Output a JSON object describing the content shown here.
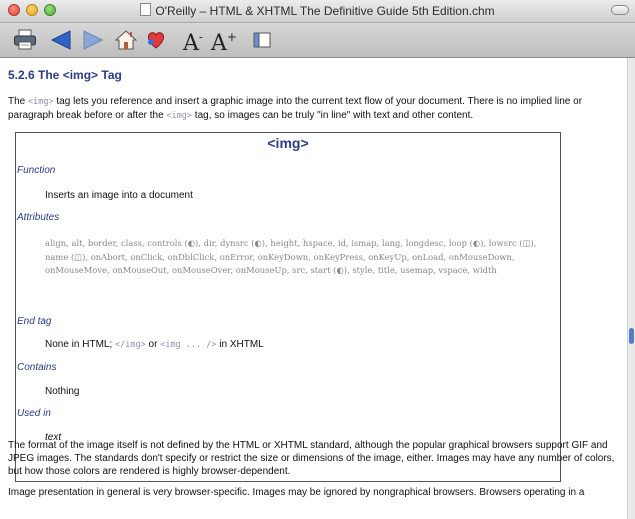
{
  "window": {
    "title": "O'Reilly – HTML & XHTML The Definitive Guide 5th Edition.chm"
  },
  "toolbar": {
    "buttons": [
      {
        "name": "print-icon"
      },
      {
        "name": "back-arrow-icon"
      },
      {
        "name": "forward-arrow-icon"
      },
      {
        "name": "home-icon"
      },
      {
        "name": "bookmark-heart-icon"
      },
      {
        "name": "font-smaller-icon",
        "label": "A",
        "sup": "-"
      },
      {
        "name": "font-larger-icon",
        "label": "A",
        "sup": "+"
      },
      {
        "name": "sidebar-toggle-icon"
      }
    ]
  },
  "section": {
    "heading": "5.2.6 The <img> Tag"
  },
  "intro": {
    "t1": "The ",
    "tag1": "<img>",
    "t2": " tag lets you reference and insert a graphic image into the current text flow of your document. There is no implied line or paragraph break before or after the ",
    "tag2": "<img>",
    "t3": " tag, so images can be truly \"in line\" with text and other content."
  },
  "ref": {
    "title": "<img>",
    "function_label": "Function",
    "function_value": "Inserts an image into a document",
    "attributes_label": "Attributes",
    "attributes": [
      "align,",
      "alt,",
      "border,",
      "class,",
      "controls (◐),",
      "dir,",
      "dynsrc (◐),",
      "height,",
      "hspace,",
      "id,",
      "ismap,",
      "lang,",
      "longdesc,",
      "loop (◐),",
      "lowsrc (◫),",
      "name (◫),",
      "onAbort,",
      "onClick,",
      "onDblClick,",
      "onError,",
      "onKeyDown,",
      "onKeyPress,",
      "onKeyUp,",
      "onLoad,",
      "onMouseDown,",
      "onMouseMove,",
      "onMouseOut,",
      "onMouseOver,",
      "onMouseUp,",
      "src,",
      "start (◐),",
      "style,",
      "title,",
      "usemap,",
      "vspace,",
      "width"
    ],
    "endtag_label": "End tag",
    "endtag_t1": "None in HTML; ",
    "endtag_c1": "</img>",
    "endtag_t2": " or ",
    "endtag_c2": "<img ... />",
    "endtag_t3": " in XHTML",
    "contains_label": "Contains",
    "contains_value": "Nothing",
    "usedin_label": "Used in",
    "usedin_value": "text"
  },
  "body": {
    "para1": "The format of the image itself is not defined by the HTML or XHTML standard, although the popular graphical browsers support GIF and JPEG images. The standards don't specify or restrict the size or dimensions of the image, either. Images may have any number of colors, but how those colors are rendered is highly browser-dependent.",
    "para2": "Image presentation in general is very browser-specific. Images may be ignored by nongraphical browsers. Browsers operating in a"
  }
}
